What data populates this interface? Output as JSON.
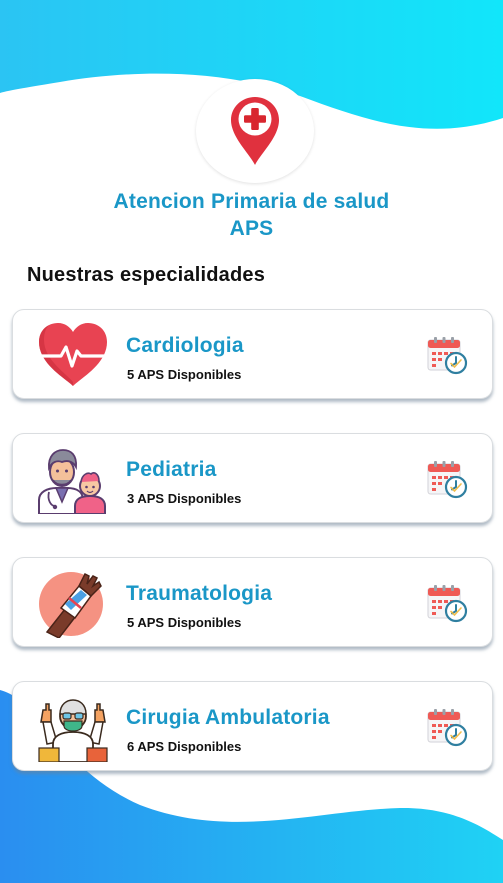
{
  "header": {
    "title_line1": "Atencion Primaria de salud",
    "title_line2": "APS",
    "logo_icon": "medical-location-pin-icon"
  },
  "section": {
    "title": "Nuestras especialidades"
  },
  "specialties": [
    {
      "name": "Cardiologia",
      "availability": "5 APS Disponibles",
      "icon": "heart-pulse-icon"
    },
    {
      "name": "Pediatria",
      "availability": "3 APS Disponibles",
      "icon": "doctor-child-icon"
    },
    {
      "name": "Traumatologia",
      "availability": "5 APS Disponibles",
      "icon": "bandaged-arm-icon"
    },
    {
      "name": "Cirugia Ambulatoria",
      "availability": "6 APS Disponibles",
      "icon": "surgeon-icon"
    }
  ],
  "colors": {
    "accent": "#1a97c7",
    "wave_light": "#1ed2f5",
    "wave_dark": "#2a8ef0",
    "pin": "#e0313e"
  },
  "action_icon": "calendar-clock-icon"
}
